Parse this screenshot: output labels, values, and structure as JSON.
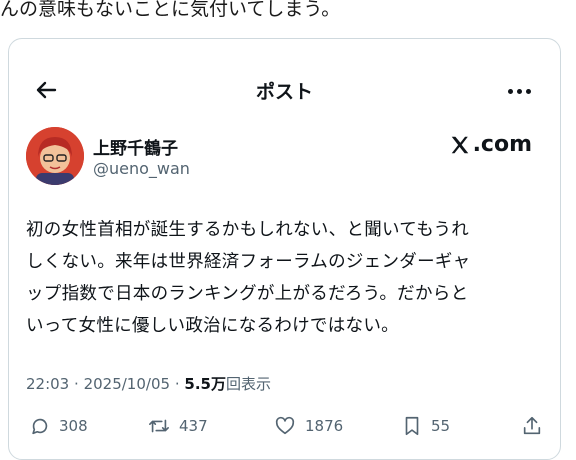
{
  "caption": "んの意味もないことに気付いてしまう。",
  "header": {
    "title": "ポスト"
  },
  "author": {
    "name": "上野千鶴子",
    "handle": "@ueno_wan"
  },
  "brand": {
    "text": ".com",
    "color": "#0f1419"
  },
  "post": {
    "text": "初の女性首相が誕生するかもしれない、と聞いてもうれ\nしくない。来年は世界経済フォーラムのジェンダーギャ\nップ指数で日本のランキングが上がるだろう。だからと\nいって女性に優しい政治になるわけではない。"
  },
  "meta": {
    "time": "22:03",
    "date": "2025/10/05",
    "views": "5.5万",
    "views_label": "回表示",
    "sep": "·"
  },
  "actions": {
    "replies": "308",
    "reposts": "437",
    "likes": "1876",
    "bookmarks": "55"
  },
  "icons": [
    "back-arrow-icon",
    "more-icon",
    "x-logo-icon",
    "reply-icon",
    "repost-icon",
    "like-icon",
    "bookmark-icon",
    "share-icon"
  ]
}
